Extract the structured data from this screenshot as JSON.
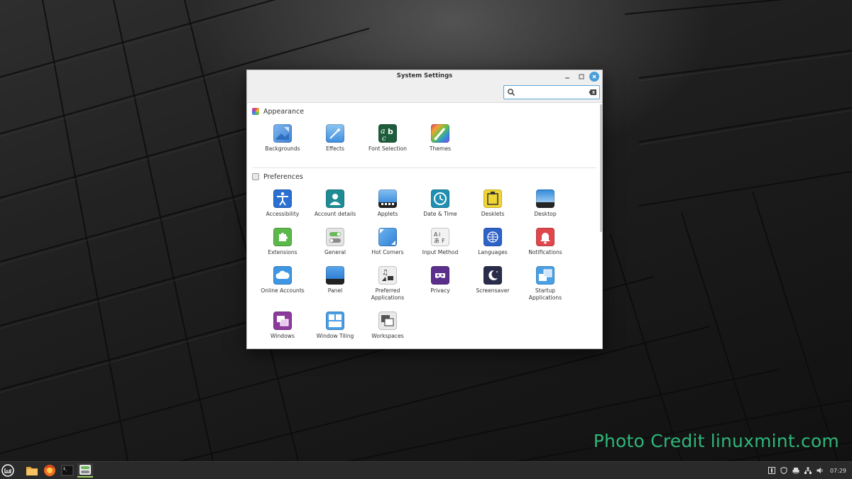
{
  "window": {
    "title": "System Settings"
  },
  "search": {
    "placeholder": "",
    "value": ""
  },
  "sections": [
    {
      "label": "Appearance",
      "items": [
        {
          "label": "Backgrounds",
          "icon": "backgrounds-icon"
        },
        {
          "label": "Effects",
          "icon": "effects-icon"
        },
        {
          "label": "Font Selection",
          "icon": "font-selection-icon"
        },
        {
          "label": "Themes",
          "icon": "themes-icon"
        }
      ]
    },
    {
      "label": "Preferences",
      "items": [
        {
          "label": "Accessibility",
          "icon": "accessibility-icon"
        },
        {
          "label": "Account details",
          "icon": "account-details-icon"
        },
        {
          "label": "Applets",
          "icon": "applets-icon"
        },
        {
          "label": "Date & Time",
          "icon": "date-time-icon"
        },
        {
          "label": "Desklets",
          "icon": "desklets-icon"
        },
        {
          "label": "Desktop",
          "icon": "desktop-icon"
        },
        {
          "label": "Extensions",
          "icon": "extensions-icon"
        },
        {
          "label": "General",
          "icon": "general-icon"
        },
        {
          "label": "Hot Corners",
          "icon": "hot-corners-icon"
        },
        {
          "label": "Input Method",
          "icon": "input-method-icon"
        },
        {
          "label": "Languages",
          "icon": "languages-icon"
        },
        {
          "label": "Notifications",
          "icon": "notifications-icon"
        },
        {
          "label": "Online Accounts",
          "icon": "online-accounts-icon"
        },
        {
          "label": "Panel",
          "icon": "panel-icon"
        },
        {
          "label": "Preferred Applications",
          "icon": "preferred-applications-icon"
        },
        {
          "label": "Privacy",
          "icon": "privacy-icon"
        },
        {
          "label": "Screensaver",
          "icon": "screensaver-icon"
        },
        {
          "label": "Startup Applications",
          "icon": "startup-applications-icon"
        },
        {
          "label": "Windows",
          "icon": "windows-icon"
        },
        {
          "label": "Window Tiling",
          "icon": "window-tiling-icon"
        },
        {
          "label": "Workspaces",
          "icon": "workspaces-icon"
        }
      ]
    }
  ],
  "taskbar": {
    "apps": [
      "menu-icon",
      "files-icon",
      "firefox-icon",
      "terminal-icon",
      "settings-icon"
    ],
    "clock": "07:29"
  },
  "credit": "Photo Credit linuxmint.com",
  "colors": {
    "accent": "#4a9fd8",
    "credit": "#2fb67a",
    "taskbar": "#2a2a2a"
  }
}
